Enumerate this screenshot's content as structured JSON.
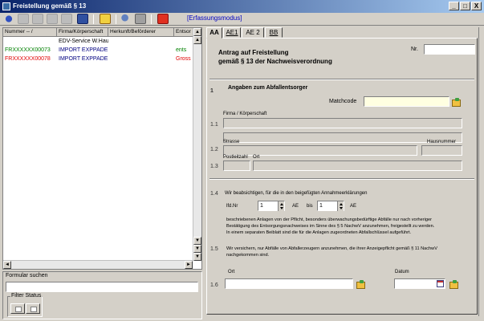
{
  "window": {
    "title": "Freistellung gemäß § 13",
    "minimize": "_",
    "maximize": "□",
    "close": "X"
  },
  "toolbar": {
    "mode": "[Erfassungsmodus]"
  },
  "list": {
    "headers": [
      "Nummer -- /",
      "Firma/Körperschaft",
      "Herkunft/Beförderer",
      "Entsor"
    ],
    "rows": [
      {
        "nummer": "",
        "firma": "EDV-Service W.Haupt",
        "entsor": "",
        "color": "#000000"
      },
      {
        "nummer": "FRXXXXXX00073",
        "firma": "IMPORT EXPPADERE",
        "entsor": "ents",
        "color": "#008000"
      },
      {
        "nummer": "FRXXXXXX00078",
        "firma": "IMPORT EXPPADERE",
        "entsor": "Gross",
        "color": "#e00000"
      }
    ]
  },
  "search": {
    "label": "Formular suchen",
    "value": ""
  },
  "filter": {
    "label": "Filter Status"
  },
  "tabs": [
    {
      "label": "AA"
    },
    {
      "label": "AE1"
    },
    {
      "label": "AE 2"
    },
    {
      "label": "BB"
    }
  ],
  "form": {
    "title_line1": "Antrag auf Freistellung",
    "title_line2": "gemäß § 13 der Nachweisverordnung",
    "nr_label": "Nr.",
    "nr_value": "",
    "section1_num": "1",
    "section1_title": "Angaben zum Abfallentsorger",
    "matchcode_label": "Matchcode",
    "s11": "1.1",
    "firma_label": "Firma / Körperschaft",
    "s12": "1.2",
    "strasse_label": "Strasse",
    "hausnummer_label": "Hausnummer",
    "s13": "1.3",
    "plz_label": "Postleitzahl",
    "ort_label": "Ort",
    "s14": "1.4",
    "s14_text": "Wir beabsichtigen, für die in den beigefügten Annahmeerklärungen",
    "lfdnr_label": "lfd.Nr",
    "lfdnr_value": "1",
    "ae_label": "AE",
    "bis_label": "bis",
    "bis_value": "1",
    "ae2_label": "AE",
    "para1": "beschriebenen Anlagen von der Pflicht, besonders überwachungsbedürftige Abfälle nur nach vorheriger",
    "para2": "Bestätigung des Entsorgungsnachweises im Sinne des § 5 NachwV anzunehmen, freigestellt zu werden.",
    "para3": "In einem separaten Beiblatt sind die für die Anlagen zugeordneten Abfallschlüssel aufgeführt.",
    "s15": "1.5",
    "s15_line1": "Wir versichern, nur Abfälle von Abfallerzeugern anzunehmen, die ihrer Anzeigepflicht gemäß § 11 NachwV",
    "s15_line2": "nachgekommen sind.",
    "ort2_label": "Ort",
    "datum_label": "Datum",
    "s16": "1.6"
  }
}
